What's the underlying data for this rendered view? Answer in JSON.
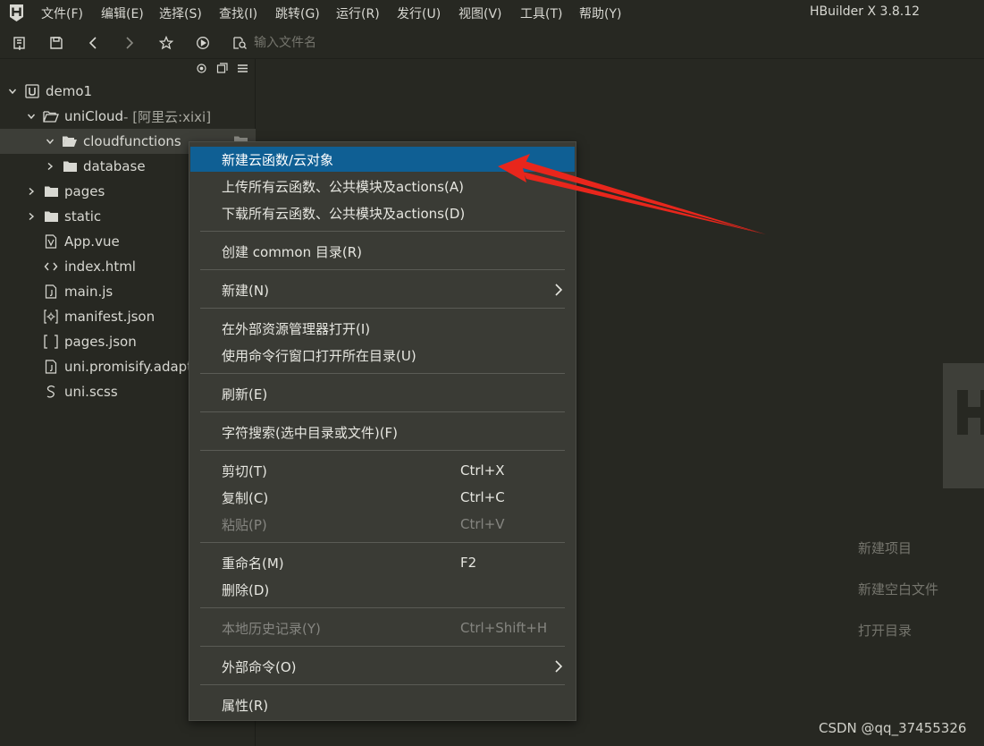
{
  "menubar": {
    "items": [
      {
        "label": "文件(F)"
      },
      {
        "label": "编辑(E)"
      },
      {
        "label": "选择(S)"
      },
      {
        "label": "查找(I)"
      },
      {
        "label": "跳转(G)"
      },
      {
        "label": "运行(R)"
      },
      {
        "label": "发行(U)"
      },
      {
        "label": "视图(V)"
      },
      {
        "label": "工具(T)"
      },
      {
        "label": "帮助(Y)"
      }
    ],
    "app_title": "HBuilder X 3.8.12"
  },
  "toolbar": {
    "search_placeholder": "输入文件名",
    "icons": [
      "new-file-icon",
      "save-icon",
      "back-icon",
      "forward-icon",
      "star-icon",
      "run-icon",
      "file-search-icon"
    ]
  },
  "sidebar": {
    "tool_icons": [
      "locate-icon",
      "collapse-icon",
      "menu-icon"
    ],
    "tree": [
      {
        "label": "demo1",
        "suffix": ""
      },
      {
        "label": "uniCloud",
        "suffix": " - [阿里云:xixi]"
      },
      {
        "label": "cloudfunctions",
        "suffix": ""
      },
      {
        "label": "database",
        "suffix": ""
      },
      {
        "label": "pages",
        "suffix": ""
      },
      {
        "label": "static",
        "suffix": ""
      },
      {
        "label": "App.vue",
        "suffix": ""
      },
      {
        "label": "index.html",
        "suffix": ""
      },
      {
        "label": "main.js",
        "suffix": ""
      },
      {
        "label": "manifest.json",
        "suffix": ""
      },
      {
        "label": "pages.json",
        "suffix": ""
      },
      {
        "label": "uni.promisify.adaptor.js",
        "suffix": ""
      },
      {
        "label": "uni.scss",
        "suffix": ""
      }
    ]
  },
  "context_menu": {
    "items": [
      {
        "label": "新建云函数/云对象",
        "shortcut": ""
      },
      {
        "label": "上传所有云函数、公共模块及actions(A)",
        "shortcut": ""
      },
      {
        "label": "下载所有云函数、公共模块及actions(D)",
        "shortcut": ""
      },
      {
        "label": "创建 common 目录(R)",
        "shortcut": ""
      },
      {
        "label": "新建(N)",
        "shortcut": ""
      },
      {
        "label": "在外部资源管理器打开(I)",
        "shortcut": ""
      },
      {
        "label": "使用命令行窗口打开所在目录(U)",
        "shortcut": ""
      },
      {
        "label": "刷新(E)",
        "shortcut": ""
      },
      {
        "label": "字符搜索(选中目录或文件)(F)",
        "shortcut": ""
      },
      {
        "label": "剪切(T)",
        "shortcut": "Ctrl+X"
      },
      {
        "label": "复制(C)",
        "shortcut": "Ctrl+C"
      },
      {
        "label": "粘贴(P)",
        "shortcut": "Ctrl+V"
      },
      {
        "label": "重命名(M)",
        "shortcut": "F2"
      },
      {
        "label": "删除(D)",
        "shortcut": ""
      },
      {
        "label": "本地历史记录(Y)",
        "shortcut": "Ctrl+Shift+H"
      },
      {
        "label": "外部命令(O)",
        "shortcut": ""
      },
      {
        "label": "属性(R)",
        "shortcut": ""
      }
    ],
    "highlight_color": "#0f5f94"
  },
  "welcome": {
    "new_project": "新建项目",
    "new_blank_file": "新建空白文件",
    "open_directory": "打开目录"
  },
  "credit": "CSDN @qq_37455326",
  "colors": {
    "background": "#272822",
    "menu_background": "#3a3b35",
    "annotation_arrow": "#e8261c"
  }
}
